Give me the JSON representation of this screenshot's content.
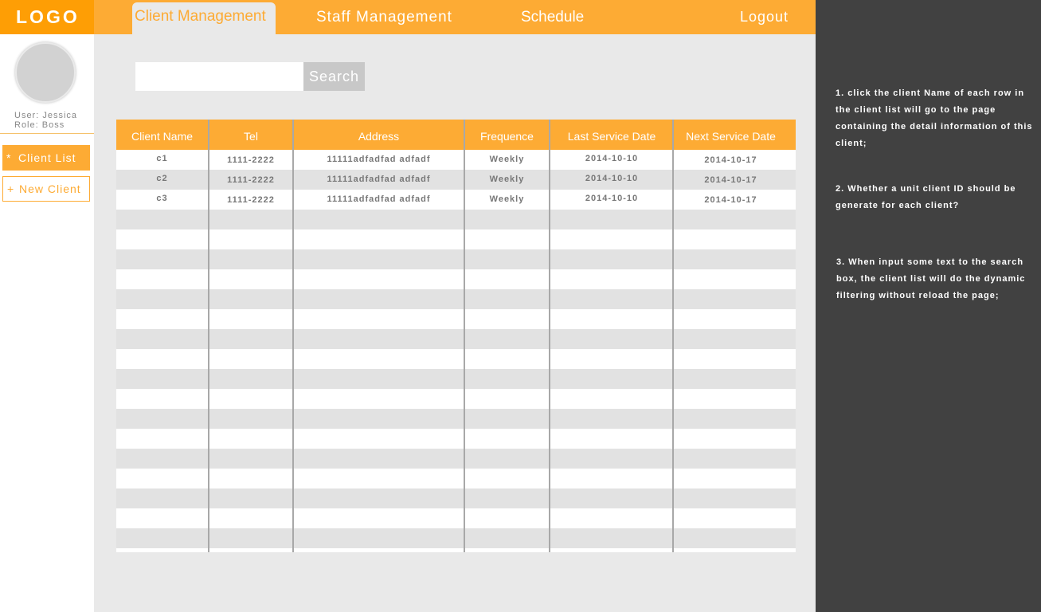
{
  "header": {
    "logo": "LOGO",
    "tabs": {
      "client": "Client Management",
      "staff": "Staff Management",
      "schedule": "Schedule"
    },
    "logout": "Logout"
  },
  "sidebar": {
    "user_line": "User: Jessica",
    "role_line": "Role: Boss",
    "client_list": {
      "icon": "*",
      "label": "Client List"
    },
    "new_client": {
      "icon": "+",
      "label": "New Client"
    }
  },
  "search": {
    "value": "",
    "placeholder": "",
    "button_label": "Search"
  },
  "table": {
    "headers": {
      "name": "Client Name",
      "tel": "Tel",
      "address": "Address",
      "frequence": "Frequence",
      "last": "Last Service Date",
      "next": "Next Service Date"
    },
    "rows": [
      {
        "name": "c1",
        "tel": "1111-2222",
        "address": "11111adfadfad adfadf",
        "frequence": "Weekly",
        "last": "2014-10-10",
        "next": "2014-10-17"
      },
      {
        "name": "c2",
        "tel": "1111-2222",
        "address": "11111adfadfad adfadf",
        "frequence": "Weekly",
        "last": "2014-10-10",
        "next": "2014-10-17"
      },
      {
        "name": "c3",
        "tel": "1111-2222",
        "address": "11111adfadfad adfadf",
        "frequence": "Weekly",
        "last": "2014-10-10",
        "next": "2014-10-17"
      }
    ]
  },
  "notes": {
    "n1": "1.  click the client Name of each row in the client list will go to the page containing the detail information of this client;",
    "n2": "2. Whether a unit client ID should be  generate for each client?",
    "n3": "3. When input some text to the search box, the client list will do the dynamic filtering without reload the page;"
  },
  "colors": {
    "accent": "#fdab34",
    "logo_bg": "#fe9e05",
    "notes_bg": "#414141",
    "content_bg": "#e9e9e9"
  }
}
